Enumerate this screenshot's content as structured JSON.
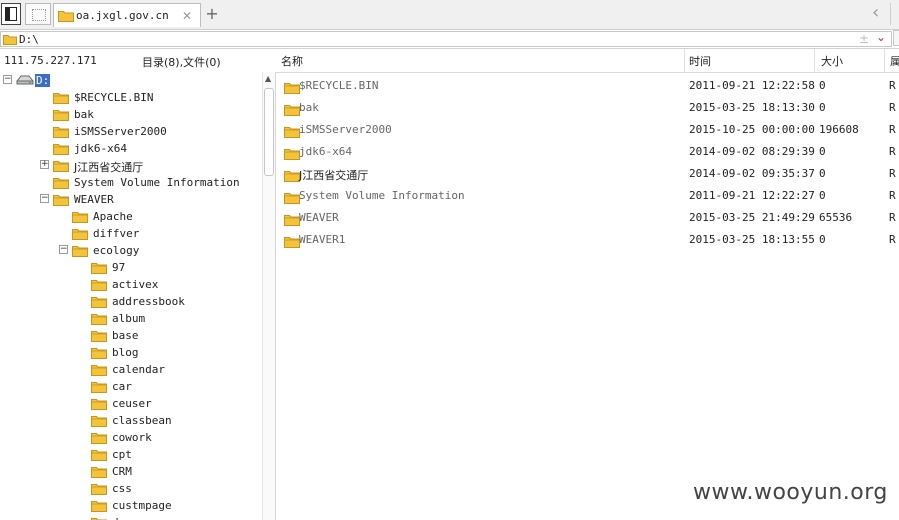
{
  "tab": {
    "title": "oa.jxgl.gov.cn",
    "close": "✕",
    "add": "+",
    "back": "‹"
  },
  "address": {
    "value": "D:\\",
    "plus": "±",
    "dropdown": "⌄"
  },
  "status": {
    "host": "111.75.227.171",
    "summary": "目录(8),文件(0)"
  },
  "columns": {
    "name": "名称",
    "time": "时间",
    "size": "大小",
    "attr": "属"
  },
  "tree": [
    {
      "label": "D:",
      "level": 0,
      "toggle": "-",
      "icon": "drive",
      "selected": true
    },
    {
      "label": "$RECYCLE.BIN",
      "level": 1,
      "toggle": "",
      "icon": "folder"
    },
    {
      "label": "bak",
      "level": 1,
      "toggle": "",
      "icon": "folder"
    },
    {
      "label": "iSMSServer2000",
      "level": 1,
      "toggle": "",
      "icon": "folder"
    },
    {
      "label": "jdk6-x64",
      "level": 1,
      "toggle": "",
      "icon": "folder"
    },
    {
      "label": "J江西省交通厅",
      "level": 1,
      "toggle": "+",
      "icon": "folder"
    },
    {
      "label": "System Volume Information",
      "level": 1,
      "toggle": "",
      "icon": "folder"
    },
    {
      "label": "WEAVER",
      "level": 1,
      "toggle": "-",
      "icon": "folder"
    },
    {
      "label": "Apache",
      "level": 2,
      "toggle": "",
      "icon": "folder"
    },
    {
      "label": "diffver",
      "level": 2,
      "toggle": "",
      "icon": "folder"
    },
    {
      "label": "ecology",
      "level": 2,
      "toggle": "-",
      "icon": "folder"
    },
    {
      "label": "97",
      "level": 3,
      "toggle": "",
      "icon": "folder"
    },
    {
      "label": "activex",
      "level": 3,
      "toggle": "",
      "icon": "folder"
    },
    {
      "label": "addressbook",
      "level": 3,
      "toggle": "",
      "icon": "folder"
    },
    {
      "label": "album",
      "level": 3,
      "toggle": "",
      "icon": "folder"
    },
    {
      "label": "base",
      "level": 3,
      "toggle": "",
      "icon": "folder"
    },
    {
      "label": "blog",
      "level": 3,
      "toggle": "",
      "icon": "folder"
    },
    {
      "label": "calendar",
      "level": 3,
      "toggle": "",
      "icon": "folder"
    },
    {
      "label": "car",
      "level": 3,
      "toggle": "",
      "icon": "folder"
    },
    {
      "label": "ceuser",
      "level": 3,
      "toggle": "",
      "icon": "folder"
    },
    {
      "label": "classbean",
      "level": 3,
      "toggle": "",
      "icon": "folder"
    },
    {
      "label": "cowork",
      "level": 3,
      "toggle": "",
      "icon": "folder"
    },
    {
      "label": "cpt",
      "level": 3,
      "toggle": "",
      "icon": "folder"
    },
    {
      "label": "CRM",
      "level": 3,
      "toggle": "",
      "icon": "folder"
    },
    {
      "label": "css",
      "level": 3,
      "toggle": "",
      "icon": "folder"
    },
    {
      "label": "custmpage",
      "level": 3,
      "toggle": "",
      "icon": "folder"
    },
    {
      "label": "d",
      "level": 3,
      "toggle": "",
      "icon": "folder"
    }
  ],
  "files": [
    {
      "name": "$RECYCLE.BIN",
      "time": "2011-09-21 12:22:58",
      "size": "0",
      "attr": "R"
    },
    {
      "name": "bak",
      "time": "2015-03-25 18:13:30",
      "size": "0",
      "attr": "R"
    },
    {
      "name": "iSMSServer2000",
      "time": "2015-10-25 00:00:00",
      "size": "196608",
      "attr": "R"
    },
    {
      "name": "jdk6-x64",
      "time": "2014-09-02 08:29:39",
      "size": "0",
      "attr": "R"
    },
    {
      "name": "J江西省交通厅",
      "time": "2014-09-02 09:35:37",
      "size": "0",
      "attr": "R"
    },
    {
      "name": "System Volume Information",
      "time": "2011-09-21 12:22:27",
      "size": "0",
      "attr": "R"
    },
    {
      "name": "WEAVER",
      "time": "2015-03-25 21:49:29",
      "size": "65536",
      "attr": "R"
    },
    {
      "name": "WEAVER1",
      "time": "2015-03-25 18:13:55",
      "size": "0",
      "attr": "R"
    }
  ],
  "watermark": "www.wooyun.org",
  "colors": {
    "folder": "#f3c33c",
    "folder_dark": "#c9951c",
    "selection": "#3a6fc4"
  }
}
